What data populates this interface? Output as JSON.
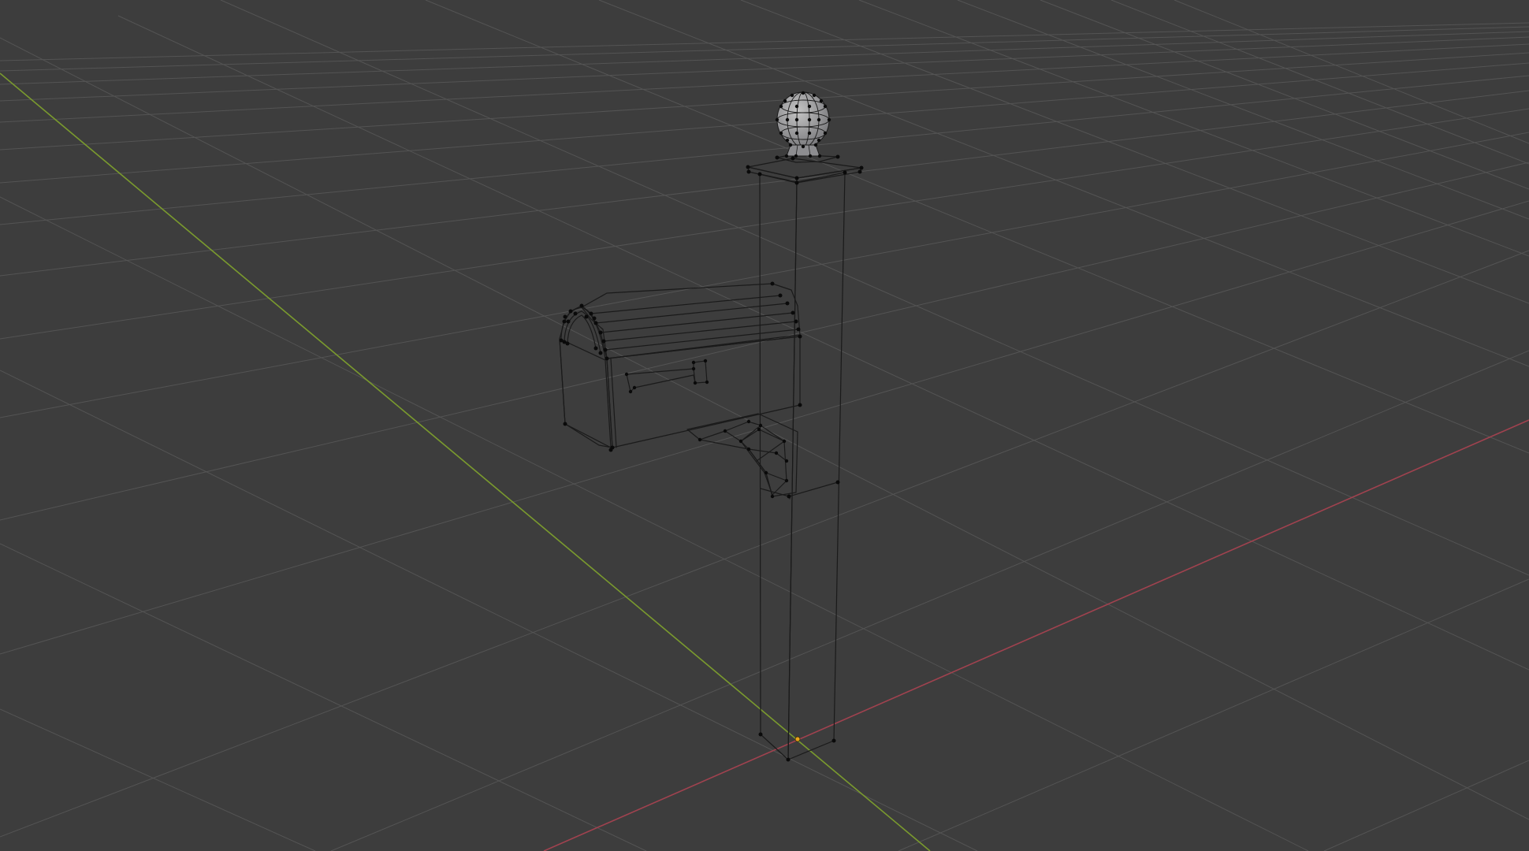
{
  "viewport": {
    "background_color": "#3d3d3d",
    "grid_color": "#545454",
    "x_axis_color": "#a0424f",
    "y_axis_color": "#7a9a2e",
    "object_light_color": "#a9a9a9",
    "object_dark_color": "#6f7075",
    "vertex_color": "#0a0a0a",
    "origin_color": "#e8a21a"
  },
  "scene": {
    "object": "mailbox-post",
    "mode": "edit-mode-wireframe-vertices"
  }
}
